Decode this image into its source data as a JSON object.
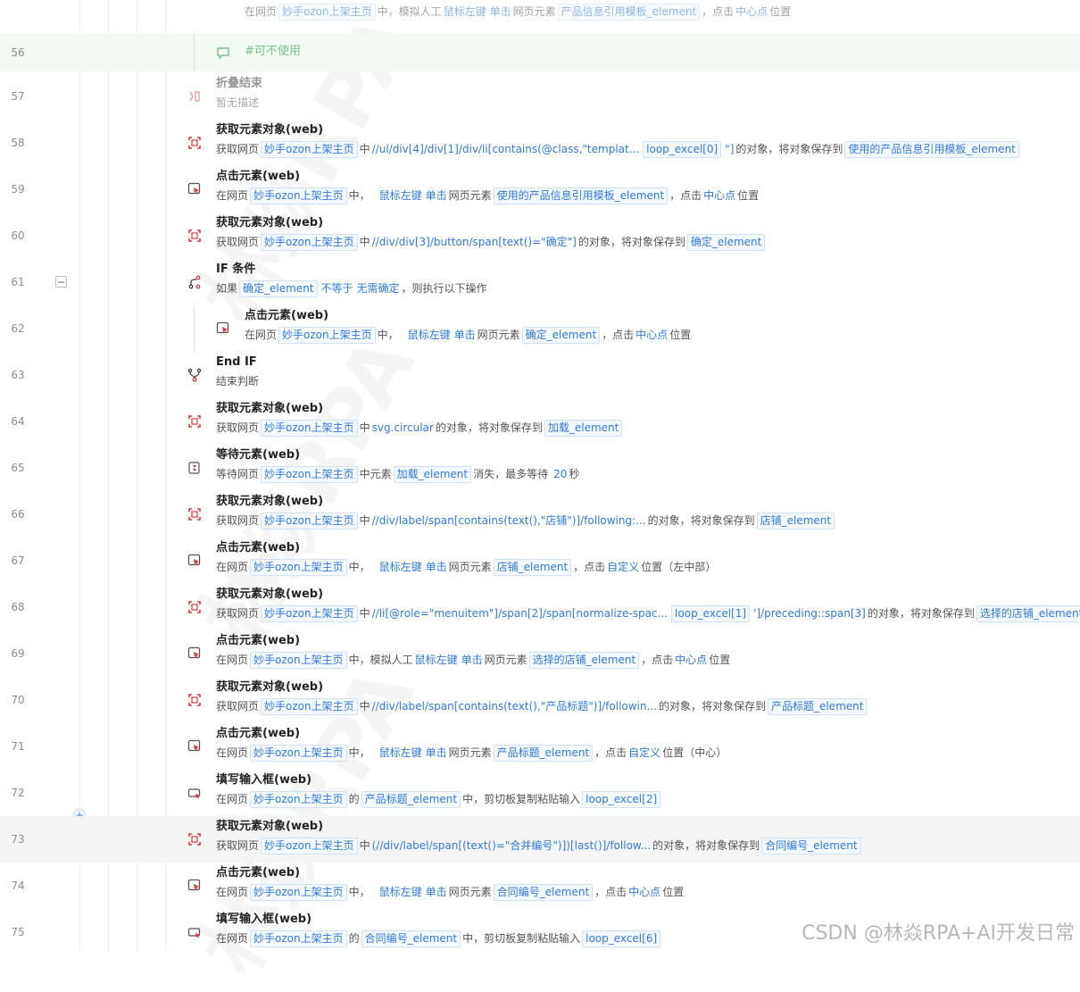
{
  "rows": [
    {
      "num": "56",
      "comment": "#可不使用"
    },
    {
      "num": "57",
      "title": "折叠结束",
      "desc": "暂无描述"
    },
    {
      "num": "58",
      "title": "获取元素对象(web)"
    },
    {
      "num": "59",
      "title": "点击元素(web)"
    },
    {
      "num": "60",
      "title": "获取元素对象(web)"
    },
    {
      "num": "61",
      "title": "IF 条件"
    },
    {
      "num": "62",
      "title": "点击元素(web)"
    },
    {
      "num": "63",
      "title": "End IF",
      "desc": "结束判断"
    },
    {
      "num": "64",
      "title": "获取元素对象(web)"
    },
    {
      "num": "65",
      "title": "等待元素(web)"
    },
    {
      "num": "66",
      "title": "获取元素对象(web)"
    },
    {
      "num": "67",
      "title": "点击元素(web)"
    },
    {
      "num": "68",
      "title": "获取元素对象(web)"
    },
    {
      "num": "69",
      "title": "点击元素(web)"
    },
    {
      "num": "70",
      "title": "获取元素对象(web)"
    },
    {
      "num": "71",
      "title": "点击元素(web)"
    },
    {
      "num": "72",
      "title": "填写输入框(web)"
    },
    {
      "num": "73",
      "title": "获取元素对象(web)"
    },
    {
      "num": "74",
      "title": "点击元素(web)"
    },
    {
      "num": "75",
      "title": "填写输入框(web)"
    }
  ],
  "top_partial": {
    "t0": "在网页",
    "tag_page": "妙手ozon上架主页",
    "t1": "中，模拟人工",
    "kw_click": "鼠标左键",
    "kw_single": "单击",
    "t2": "网页元素",
    "tag_el": "产品信息引用模板_element",
    "t3": "，点击",
    "kw_center": "中心点",
    "t4": "位置"
  },
  "txt": {
    "get_page": "获取网页",
    "in_page": "在网页",
    "in": "中",
    "in_comma": "中，",
    "of": "的",
    "page": "妙手ozon上架主页",
    "obj_save": "的对象，将对象保存到",
    "left": "鼠标左键",
    "single": "单击",
    "web_el": "网页元素",
    "click_comma": "，点击",
    "center": "中心点",
    "pos": "位置",
    "if": "如果",
    "neq": "不等于",
    "no_confirm": "无需确定",
    "then": "，则执行以下操作",
    "wait_page": "等待网页",
    "in_el": "中元素",
    "disappear": "消失，最多等待",
    "twenty": "20",
    "sec": "秒",
    "custom": "自定义",
    "pos_left_mid": "位置（左中部）",
    "pos_mid": "位置（中心）",
    "mimic": "中，模拟人工",
    "paste": "中，剪切板复制粘贴输入"
  },
  "v": {
    "xp58": "//ul/div[4]/div[1]/div/li[contains(@class,\"templat...",
    "loop0": "loop_excel[0]",
    "q58": "\"]",
    "el58": "使用的产品信息引用模板_element",
    "xp60": "//div/div[3]/button/span[text()=\"确定\"]",
    "el_confirm": "确定_element",
    "xp64": "svg.circular",
    "el_load": "加载_element",
    "xp66": "//div/label/span[contains(text(),\"店铺\")]/following:...",
    "el_shop": "店铺_element",
    "xp68": "//li[@role=\"menuitem\"]/span[2]/span[normalize-spac...",
    "loop1": "loop_excel[1]",
    "xp68b": "']/preceding::span[3]",
    "el_sel_shop": "选择的店铺_element",
    "xp70": "//div/label/span[contains(text(),\"产品标题\")]/followin...",
    "el_title": "产品标题_element",
    "loop2": "loop_excel[2]",
    "xp73": "(//div/label/span[(text()=\"合并编号\")])[last()]/follow...",
    "el_contract": "合同编号_element",
    "loop6": "loop_excel[6]"
  },
  "watermark": "CSDN @林焱RPA+AI开发日常",
  "bg_mark": "林焱RPA"
}
